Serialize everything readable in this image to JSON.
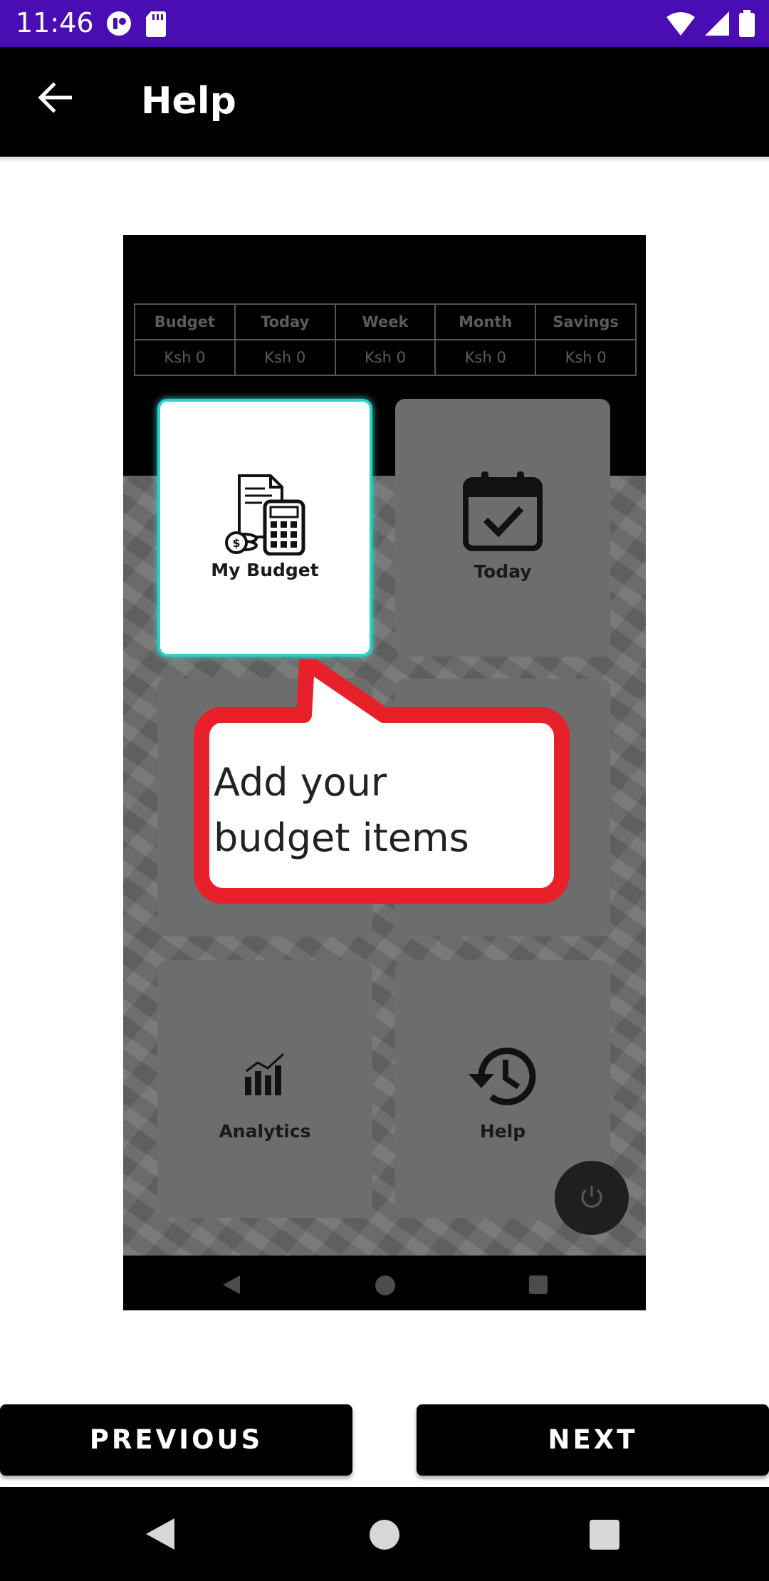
{
  "status_bar": {
    "time": "11:46",
    "left_icons": [
      "app-notification-icon",
      "sd-card-icon"
    ],
    "right_icons": [
      "wifi-icon",
      "signal-icon",
      "battery-icon"
    ]
  },
  "app_bar": {
    "title": "Help",
    "back_icon": "arrow-back-icon"
  },
  "preview": {
    "stats_headers": [
      "Budget",
      "Today",
      "Week",
      "Month",
      "Savings"
    ],
    "stats_values": [
      "Ksh 0",
      "Ksh 0",
      "Ksh 0",
      "Ksh 0",
      "Ksh 0"
    ],
    "tiles": {
      "my_budget": "My Budget",
      "today": "Today",
      "analytics": "Analytics",
      "help": "Help"
    },
    "callout_text": "Add your budget items"
  },
  "buttons": {
    "previous": "PREVIOUS",
    "next": "NEXT"
  },
  "colors": {
    "status_bar": "#4a0cb3",
    "highlight": "#2ed0c9",
    "callout_border": "#e8202a"
  }
}
